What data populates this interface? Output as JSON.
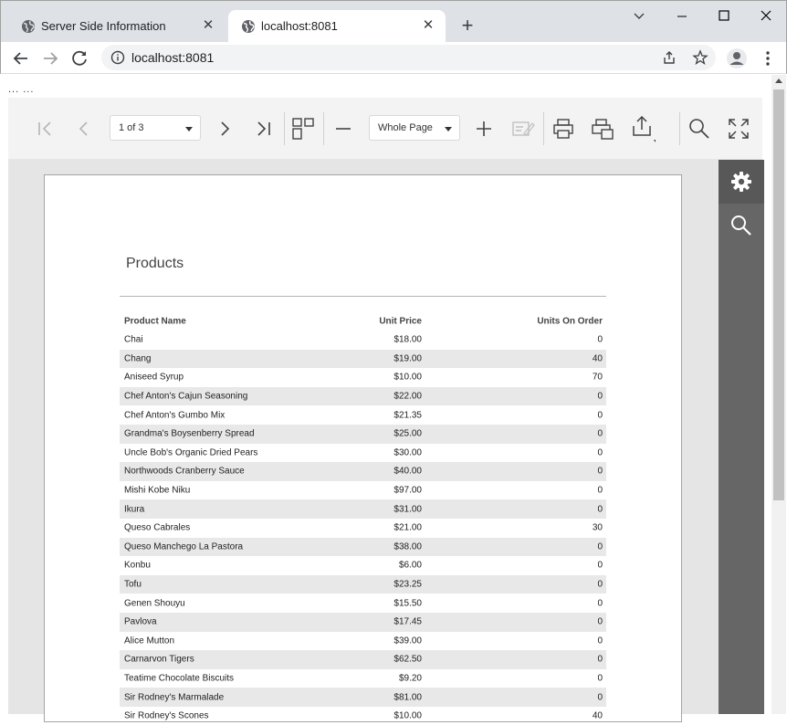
{
  "browser": {
    "tabs": [
      {
        "title": "Server Side Information",
        "active": false
      },
      {
        "title": "localhost:8081",
        "active": true
      }
    ],
    "url": "localhost:8081"
  },
  "page": {
    "dots": "... ..."
  },
  "toolbar": {
    "page_selector": "1 of 3",
    "zoom_selector": "Whole Page"
  },
  "report": {
    "title": "Products",
    "columns": [
      "Product Name",
      "Unit Price",
      "Units On Order"
    ],
    "rows": [
      [
        "Chai",
        "$18.00",
        "0"
      ],
      [
        "Chang",
        "$19.00",
        "40"
      ],
      [
        "Aniseed Syrup",
        "$10.00",
        "70"
      ],
      [
        "Chef Anton's Cajun Seasoning",
        "$22.00",
        "0"
      ],
      [
        "Chef Anton's Gumbo Mix",
        "$21.35",
        "0"
      ],
      [
        "Grandma's Boysenberry Spread",
        "$25.00",
        "0"
      ],
      [
        "Uncle Bob's Organic Dried Pears",
        "$30.00",
        "0"
      ],
      [
        "Northwoods Cranberry Sauce",
        "$40.00",
        "0"
      ],
      [
        "Mishi Kobe Niku",
        "$97.00",
        "0"
      ],
      [
        "Ikura",
        "$31.00",
        "0"
      ],
      [
        "Queso Cabrales",
        "$21.00",
        "30"
      ],
      [
        "Queso Manchego La Pastora",
        "$38.00",
        "0"
      ],
      [
        "Konbu",
        "$6.00",
        "0"
      ],
      [
        "Tofu",
        "$23.25",
        "0"
      ],
      [
        "Genen Shouyu",
        "$15.50",
        "0"
      ],
      [
        "Pavlova",
        "$17.45",
        "0"
      ],
      [
        "Alice Mutton",
        "$39.00",
        "0"
      ],
      [
        "Carnarvon Tigers",
        "$62.50",
        "0"
      ],
      [
        "Teatime Chocolate Biscuits",
        "$9.20",
        "0"
      ],
      [
        "Sir Rodney's Marmalade",
        "$81.00",
        "0"
      ],
      [
        "Sir Rodney's Scones",
        "$10.00",
        "40"
      ]
    ]
  },
  "colors": {
    "side_panel": "#666666",
    "viewer_bg": "#e5e5e5",
    "row_alt": "#e8e8e8"
  }
}
